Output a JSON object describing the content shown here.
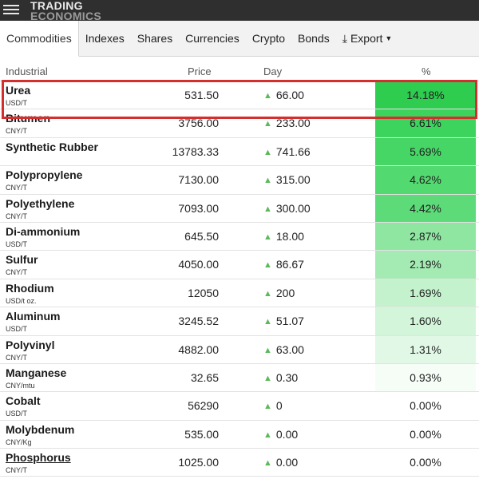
{
  "header": {
    "logo_line1": "TRADING",
    "logo_line2": "ECONOMICS"
  },
  "tabs": [
    {
      "label": "Commodities",
      "active": true
    },
    {
      "label": "Indexes"
    },
    {
      "label": "Shares"
    },
    {
      "label": "Currencies"
    },
    {
      "label": "Crypto"
    },
    {
      "label": "Bonds"
    },
    {
      "label": "Export"
    }
  ],
  "table": {
    "columns": [
      "Industrial",
      "Price",
      "Day",
      "%"
    ],
    "rows": [
      {
        "name": "Urea",
        "unit": "USD/T",
        "price": "531.50",
        "day": "66.00",
        "pct": "14.18%",
        "color": "#2ecc4f"
      },
      {
        "name": "Bitumen",
        "unit": "CNY/T",
        "price": "3756.00",
        "day": "233.00",
        "pct": "6.61%",
        "color": "#3dd45d"
      },
      {
        "name": "Synthetic Rubber",
        "unit": "",
        "price": "13783.33",
        "day": "741.66",
        "pct": "5.69%",
        "color": "#45d665"
      },
      {
        "name": "Polypropylene",
        "unit": "CNY/T",
        "price": "7130.00",
        "day": "315.00",
        "pct": "4.62%",
        "color": "#52d96f"
      },
      {
        "name": "Polyethylene",
        "unit": "CNY/T",
        "price": "7093.00",
        "day": "300.00",
        "pct": "4.42%",
        "color": "#5cdb78"
      },
      {
        "name": "Di-ammonium",
        "unit": "USD/T",
        "price": "645.50",
        "day": "18.00",
        "pct": "2.87%",
        "color": "#8ee6a1"
      },
      {
        "name": "Sulfur",
        "unit": "CNY/T",
        "price": "4050.00",
        "day": "86.67",
        "pct": "2.19%",
        "color": "#a3ebb2"
      },
      {
        "name": "Rhodium",
        "unit": "USD/t oz.",
        "price": "12050",
        "day": "200",
        "pct": "1.69%",
        "color": "#c4f2cd"
      },
      {
        "name": "Aluminum",
        "unit": "USD/T",
        "price": "3245.52",
        "day": "51.07",
        "pct": "1.60%",
        "color": "#d3f6da"
      },
      {
        "name": "Polyvinyl",
        "unit": "CNY/T",
        "price": "4882.00",
        "day": "63.00",
        "pct": "1.31%",
        "color": "#e0f8e5"
      },
      {
        "name": "Manganese",
        "unit": "CNY/mtu",
        "price": "32.65",
        "day": "0.30",
        "pct": "0.93%",
        "color": "#f6fdf7"
      },
      {
        "name": "Cobalt",
        "unit": "USD/T",
        "price": "56290",
        "day": "0",
        "pct": "0.00%",
        "color": "#ffffff"
      },
      {
        "name": "Molybdenum",
        "unit": "CNY/Kg",
        "price": "535.00",
        "day": "0.00",
        "pct": "0.00%",
        "color": "#ffffff"
      },
      {
        "name": "Phosphorus",
        "unit": "CNY/T",
        "price": "1025.00",
        "day": "0.00",
        "pct": "0.00%",
        "color": "#ffffff",
        "link": true
      }
    ]
  }
}
